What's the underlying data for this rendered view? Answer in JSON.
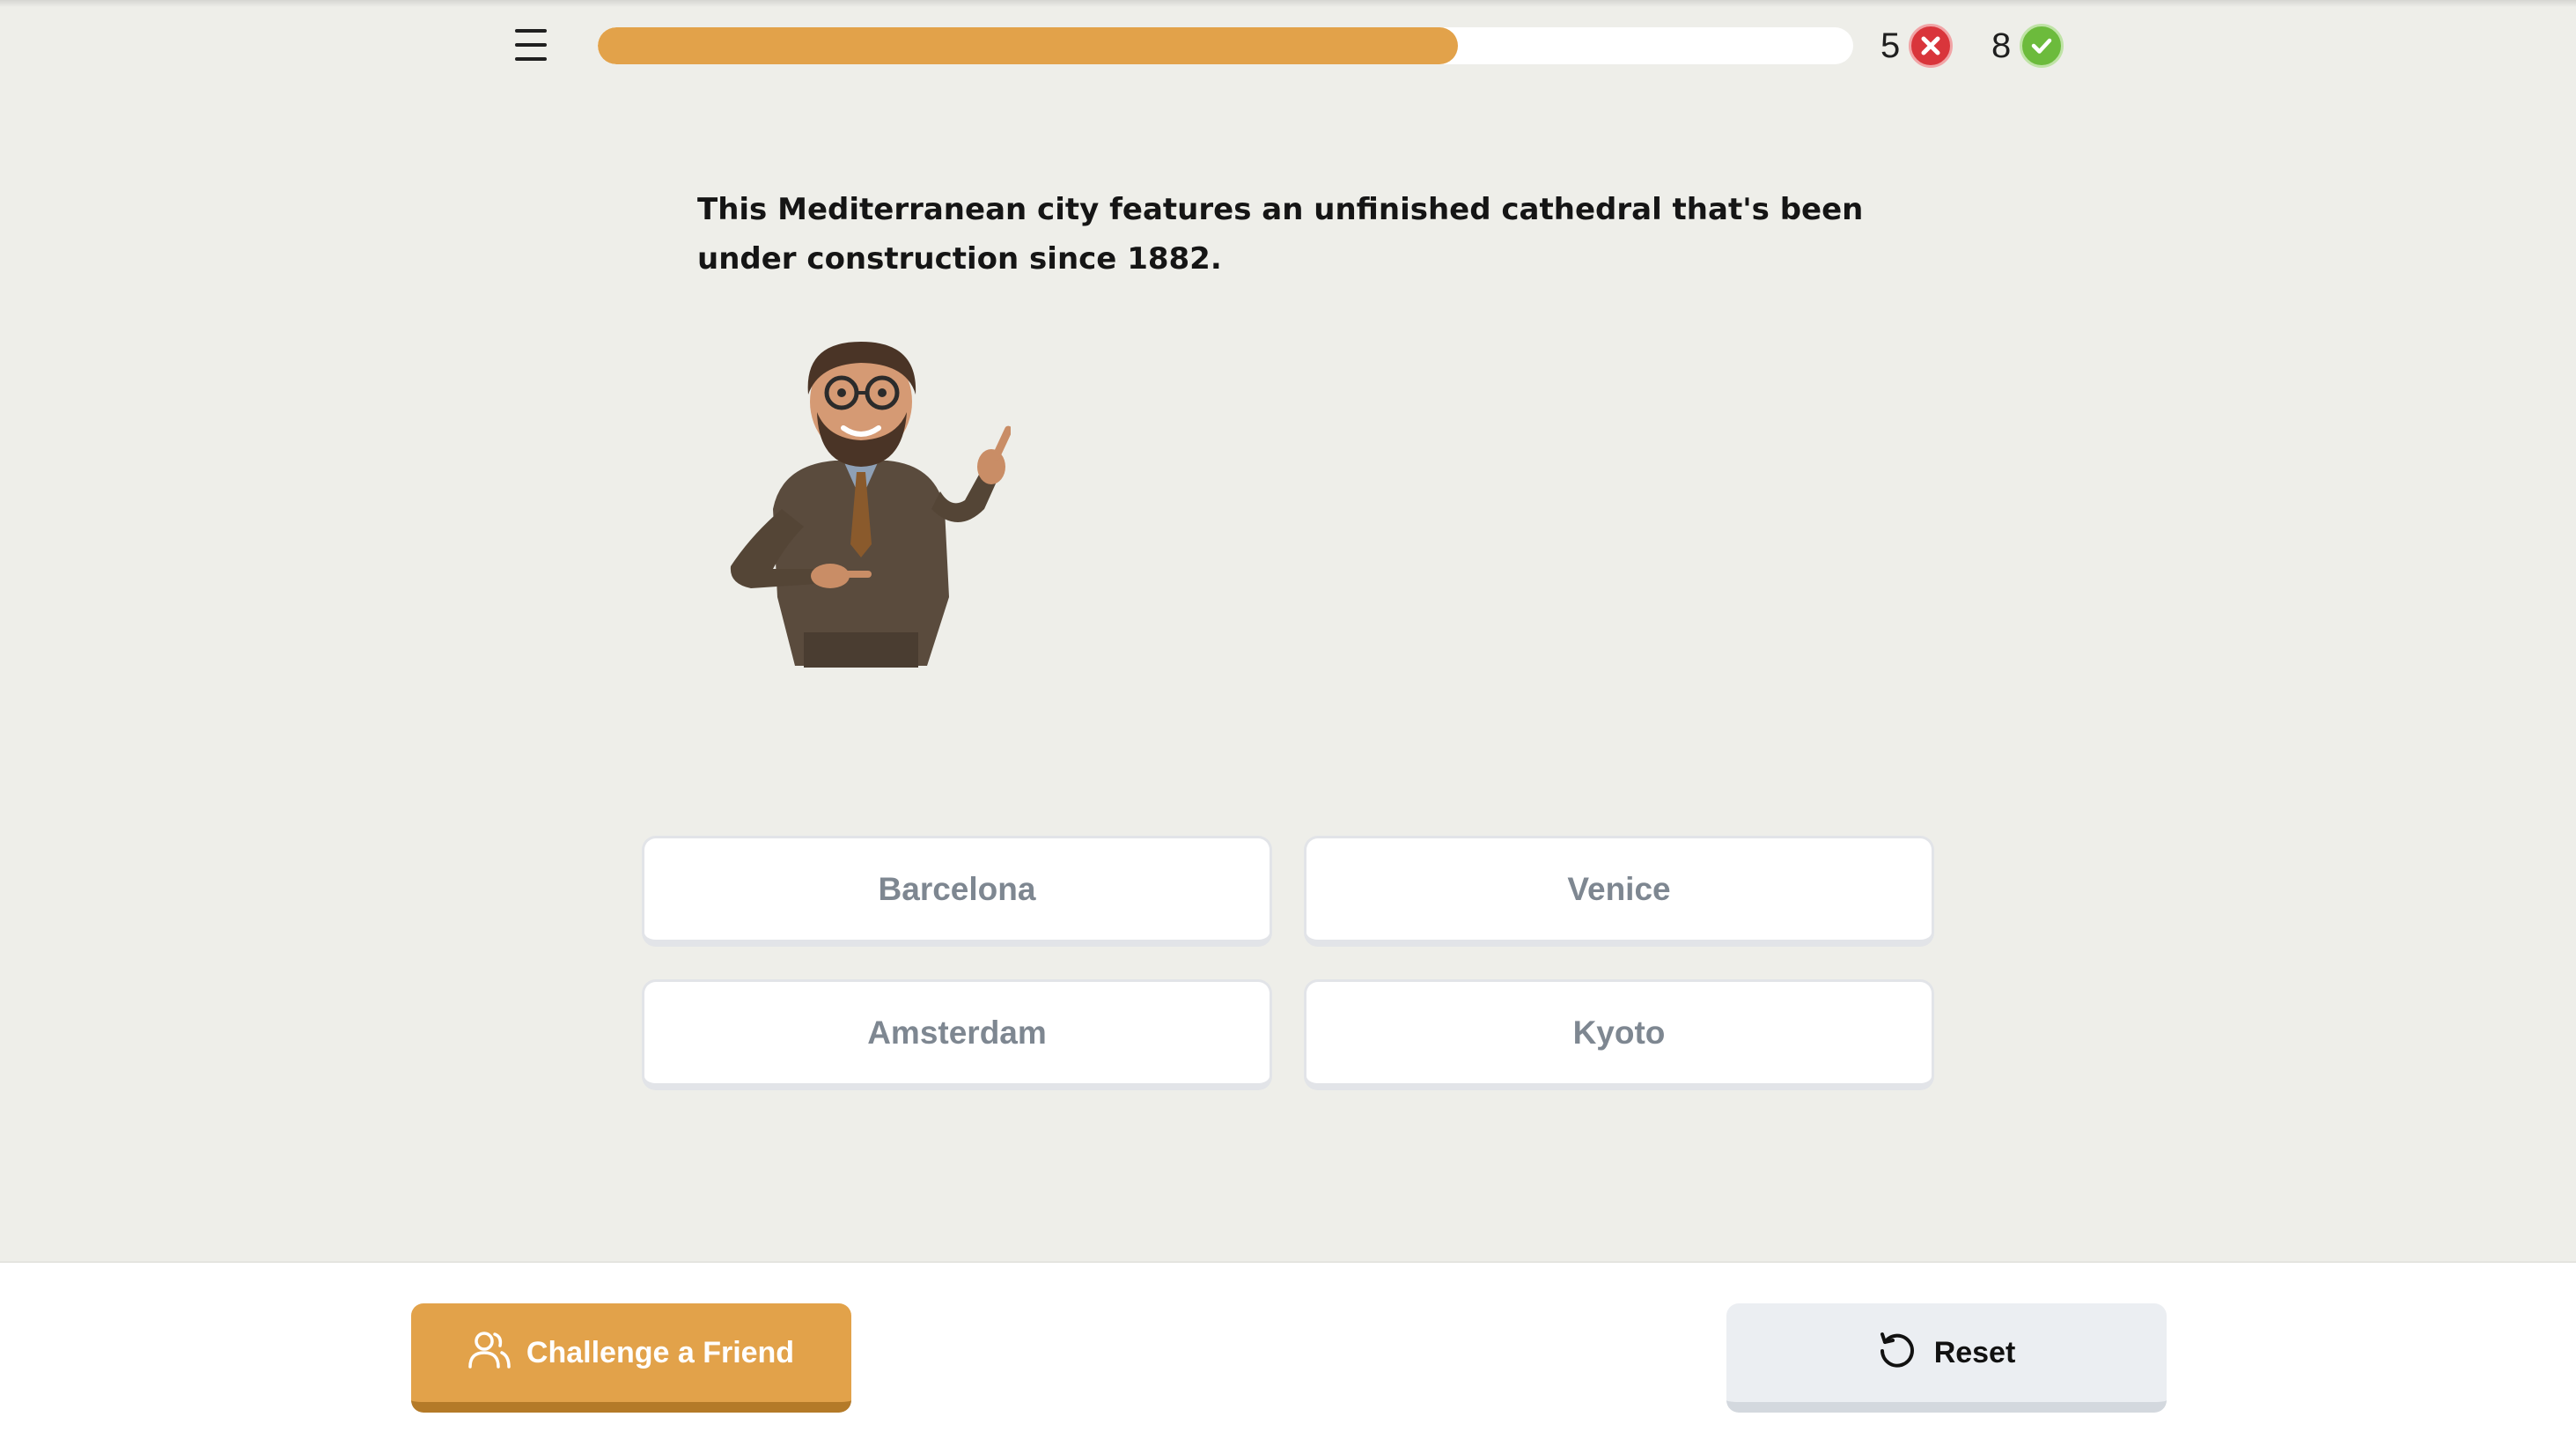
{
  "header": {
    "menu_icon": "hamburger-menu-icon",
    "progress_fraction": 0.685,
    "wrong_count": "5",
    "wrong_icon": "x-circle-icon",
    "correct_count": "8",
    "correct_icon": "check-circle-icon"
  },
  "question": {
    "text": "This Mediterranean city features an unfinished cathedral that's been under construction since 1882.",
    "illustration": "teacher-mascot-pointing"
  },
  "answers": [
    "Barcelona",
    "Venice",
    "Amsterdam",
    "Kyoto"
  ],
  "footer": {
    "challenge_label": "Challenge a Friend",
    "challenge_icon": "users-icon",
    "reset_label": "Reset",
    "reset_icon": "rotate-ccw-icon"
  },
  "colors": {
    "accent": "#e2a24a",
    "accent_dark": "#b47a28",
    "background": "#eeeee9",
    "wrong": "#d9353b",
    "correct": "#6cbb3c"
  }
}
